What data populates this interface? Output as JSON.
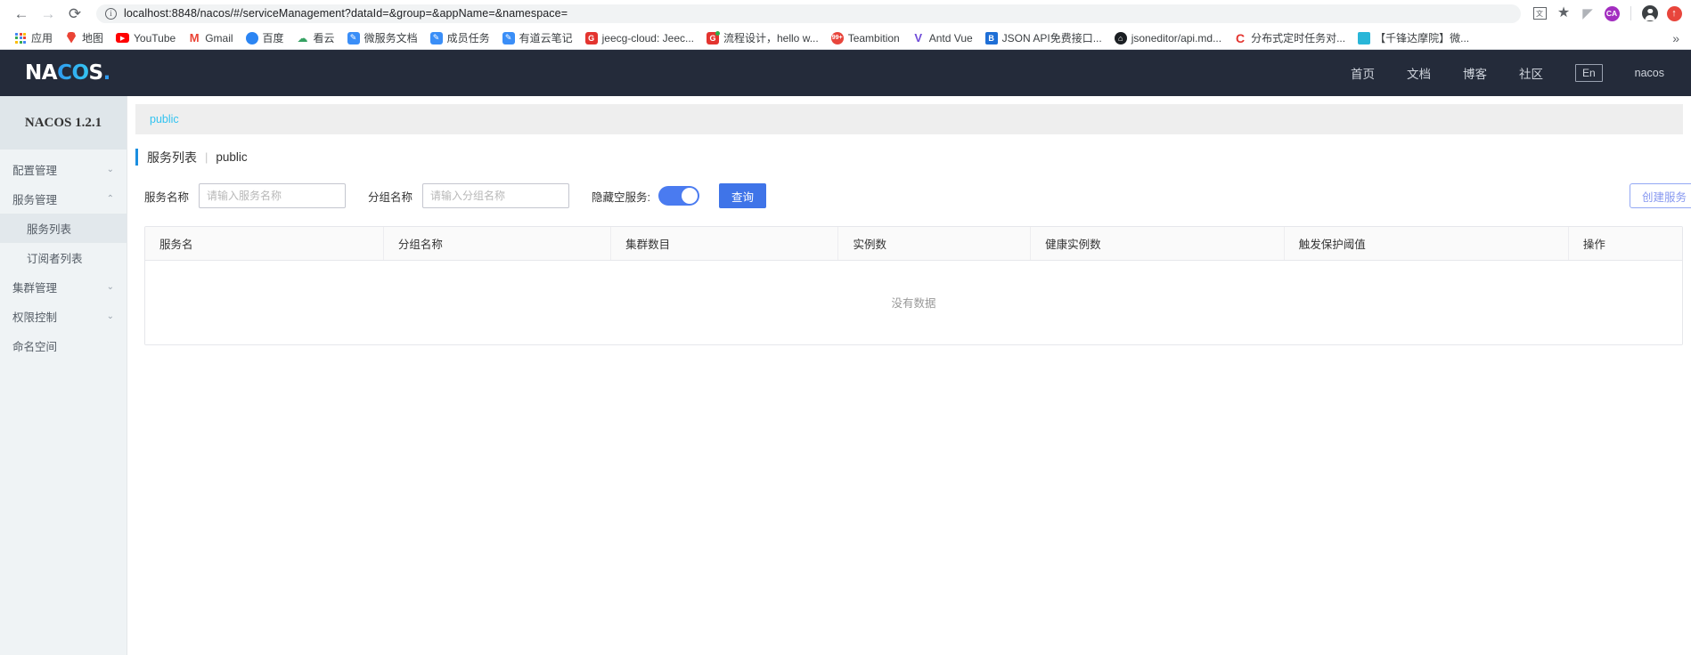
{
  "browser": {
    "back_icon": "←",
    "forward_icon": "→",
    "reload_icon": "⟳",
    "url": "localhost:8848/nacos/#/serviceManagement?dataId=&group=&appName=&namespace=",
    "info_icon_label": "i",
    "translate_icon": "translate-icon",
    "star_icon": "★",
    "extension_icon": "◤",
    "avatar_label": "CA",
    "menu_icon": "↑",
    "bookmarks_overflow": "»",
    "bookmarks": [
      {
        "label": "应用",
        "icon": "apps-grid"
      },
      {
        "label": "地图",
        "icon": "maps-pin"
      },
      {
        "label": "YouTube",
        "icon": "youtube"
      },
      {
        "label": "Gmail",
        "icon": "gmail",
        "glyph": "M"
      },
      {
        "label": "百度",
        "icon": "baidu"
      },
      {
        "label": "看云",
        "icon": "kanyun",
        "glyph": "☁"
      },
      {
        "label": "微服务文档",
        "icon": "blue-doc"
      },
      {
        "label": "成员任务",
        "icon": "blue-doc"
      },
      {
        "label": "有道云笔记",
        "icon": "blue-doc"
      },
      {
        "label": "jeecg-cloud: Jeec...",
        "icon": "gitee",
        "glyph": "G"
      },
      {
        "label": "流程设计，hello w...",
        "icon": "gitee-dot",
        "glyph": "G"
      },
      {
        "label": "Teambition",
        "icon": "teambition",
        "glyph": "99+"
      },
      {
        "label": "Antd Vue",
        "icon": "antd",
        "glyph": "V"
      },
      {
        "label": "JSON API免费接口...",
        "icon": "json",
        "glyph": "B"
      },
      {
        "label": "jsoneditor/api.md...",
        "icon": "github",
        "glyph": ""
      },
      {
        "label": "分布式定时任务对...",
        "icon": "letter-c",
        "glyph": "C"
      },
      {
        "label": "【千锋达摩院】微...",
        "icon": "calendar",
        "glyph": ""
      }
    ]
  },
  "header": {
    "logo_white_1": "NA",
    "logo_blue": "CO",
    "logo_white_2": "S",
    "logo_dot": ".",
    "nav": [
      {
        "label": "首页"
      },
      {
        "label": "文档"
      },
      {
        "label": "博客"
      },
      {
        "label": "社区"
      }
    ],
    "lang": "En",
    "user": "nacos"
  },
  "sidebar": {
    "version": "NACOS 1.2.1",
    "items": [
      {
        "label": "配置管理",
        "chevron": "⌄",
        "type": "group"
      },
      {
        "label": "服务管理",
        "chevron": "⌃",
        "type": "group"
      },
      {
        "label": "服务列表",
        "type": "sub",
        "active": true
      },
      {
        "label": "订阅者列表",
        "type": "sub",
        "active": false
      },
      {
        "label": "集群管理",
        "chevron": "⌄",
        "type": "group"
      },
      {
        "label": "权限控制",
        "chevron": "⌄",
        "type": "group"
      },
      {
        "label": "命名空间",
        "chevron": "",
        "type": "group"
      }
    ]
  },
  "main": {
    "breadcrumb": "public",
    "title": "服务列表",
    "title_separator": "|",
    "title_namespace": "public",
    "filters": {
      "service_name_label": "服务名称",
      "service_name_placeholder": "请输入服务名称",
      "service_name_value": "",
      "group_name_label": "分组名称",
      "group_name_placeholder": "请输入分组名称",
      "group_name_value": "",
      "hide_empty_label": "隐藏空服务:",
      "hide_empty_on": true,
      "query_button": "查询",
      "create_button": "创建服务"
    },
    "table": {
      "columns": [
        "服务名",
        "分组名称",
        "集群数目",
        "实例数",
        "健康实例数",
        "触发保护阈值",
        "操作"
      ],
      "rows": [],
      "empty_text": "没有数据"
    }
  }
}
